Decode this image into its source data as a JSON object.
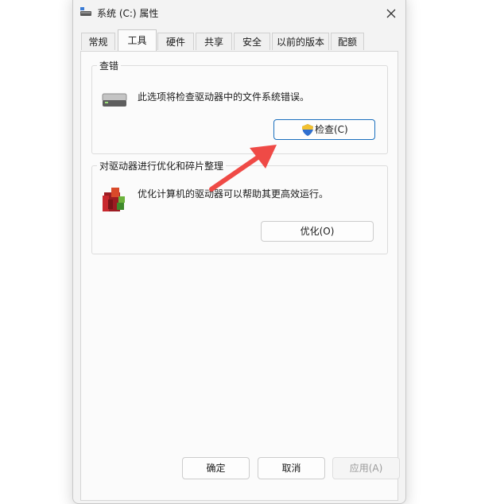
{
  "window": {
    "title": "系统 (C:) 属性",
    "close_icon": "close-icon"
  },
  "tabs": [
    {
      "label": "常规",
      "active": false
    },
    {
      "label": "工具",
      "active": true
    },
    {
      "label": "硬件",
      "active": false
    },
    {
      "label": "共享",
      "active": false
    },
    {
      "label": "安全",
      "active": false
    },
    {
      "label": "以前的版本",
      "active": false
    },
    {
      "label": "配额",
      "active": false
    }
  ],
  "error_check": {
    "title": "查错",
    "description": "此选项将检查驱动器中的文件系统错误。",
    "button_label": "检查(C)",
    "icon": "drive-icon",
    "button_icon": "uac-shield-icon"
  },
  "optimize": {
    "title": "对驱动器进行优化和碎片整理",
    "description": "优化计算机的驱动器可以帮助其更高效运行。",
    "button_label": "优化(O)",
    "icon": "defrag-icon"
  },
  "footer": {
    "ok_label": "确定",
    "cancel_label": "取消",
    "apply_label": "应用(A)",
    "apply_enabled": false
  },
  "colors": {
    "accent": "#1a6fbe",
    "annotation_arrow": "#ef4a46"
  }
}
